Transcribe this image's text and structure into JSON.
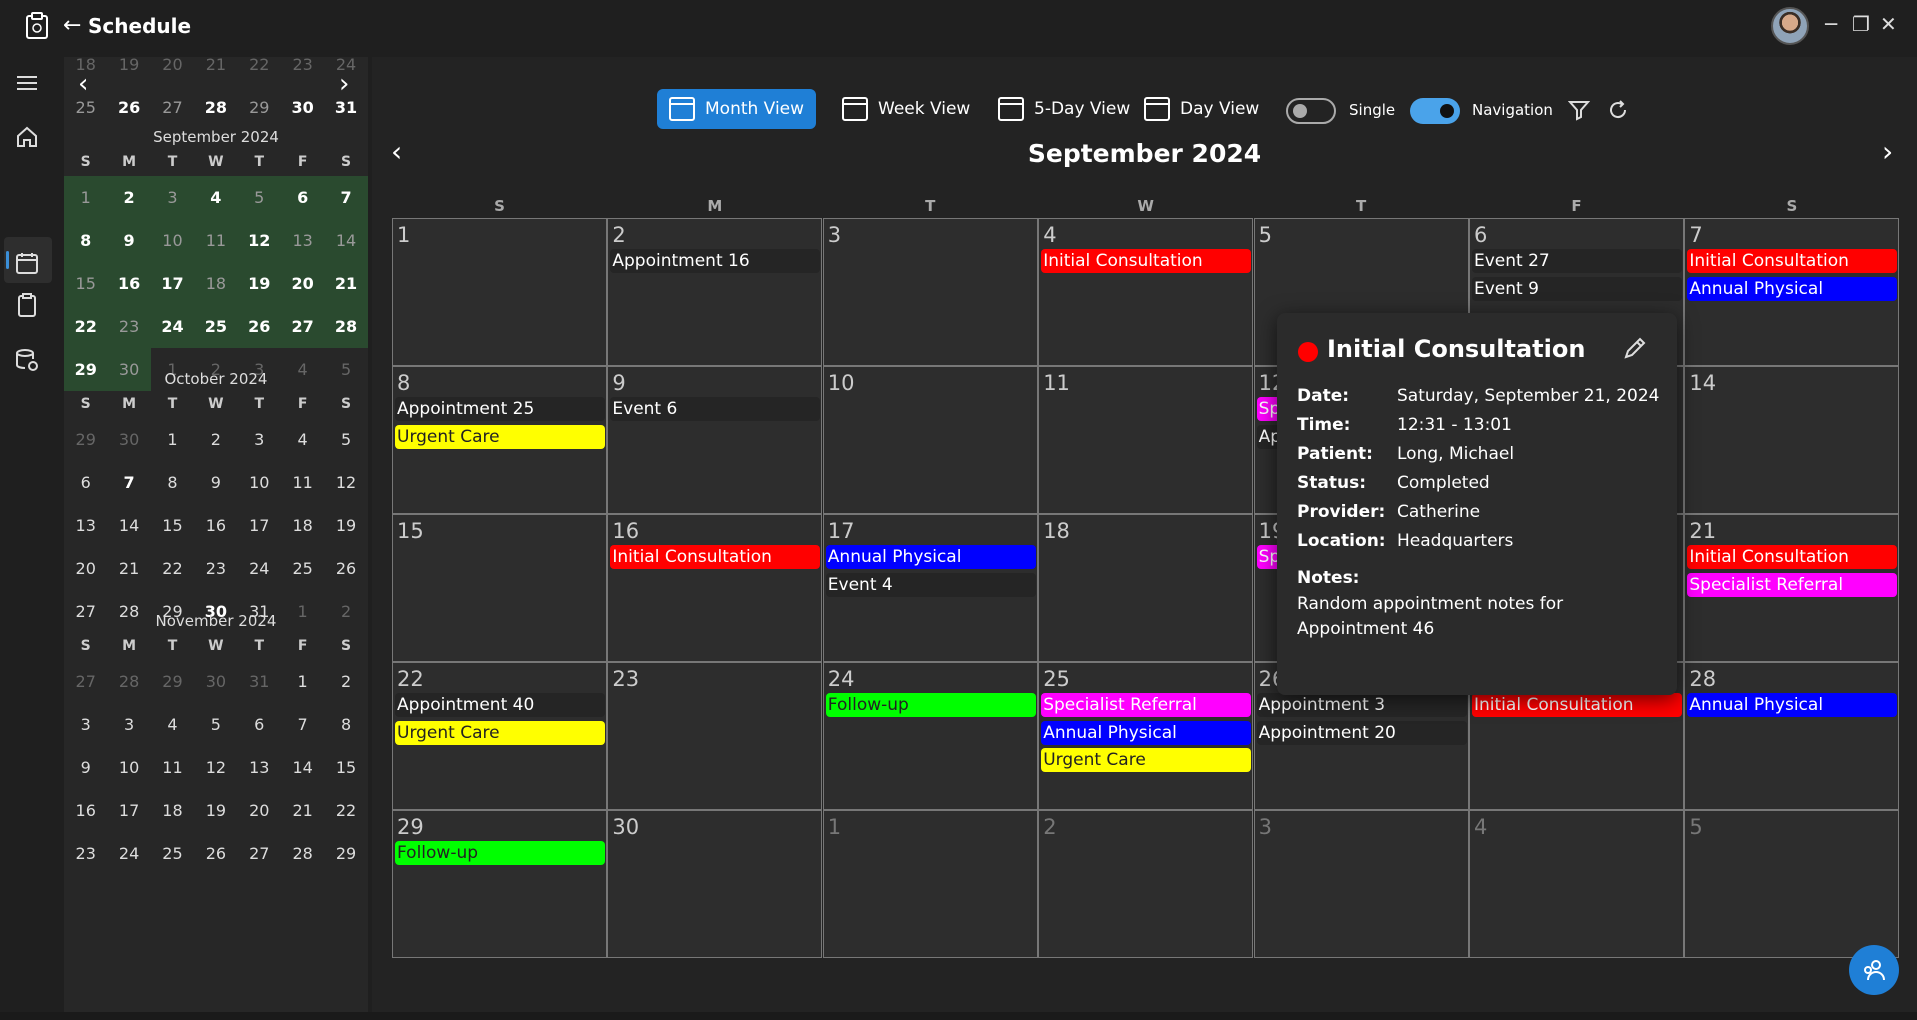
{
  "app": {
    "title": "Schedule"
  },
  "nav_rail": [
    "menu-icon",
    "home-icon",
    "calendar-icon",
    "clipboard-icon",
    "database-settings-icon"
  ],
  "mini_calendars": [
    {
      "title": "",
      "rows": [
        [
          "18",
          "19",
          "20",
          "21",
          "22",
          "23",
          "24"
        ],
        [
          "25",
          "26",
          "27",
          "28",
          "29",
          "30",
          "31"
        ]
      ]
    },
    {
      "title": "September 2024",
      "days": [
        "S",
        "M",
        "T",
        "W",
        "T",
        "F",
        "S"
      ],
      "rows": [
        [
          "1",
          "2",
          "3",
          "4",
          "5",
          "6",
          "7"
        ],
        [
          "8",
          "9",
          "10",
          "11",
          "12",
          "13",
          "14"
        ],
        [
          "15",
          "16",
          "17",
          "18",
          "19",
          "20",
          "21"
        ],
        [
          "22",
          "23",
          "24",
          "25",
          "26",
          "27",
          "28"
        ],
        [
          "29",
          "30",
          "1",
          "2",
          "3",
          "4",
          "5"
        ]
      ]
    },
    {
      "title": "October 2024",
      "days": [
        "S",
        "M",
        "T",
        "W",
        "T",
        "F",
        "S"
      ],
      "rows": [
        [
          "29",
          "30",
          "1",
          "2",
          "3",
          "4",
          "5"
        ],
        [
          "6",
          "7",
          "8",
          "9",
          "10",
          "11",
          "12"
        ],
        [
          "13",
          "14",
          "15",
          "16",
          "17",
          "18",
          "19"
        ],
        [
          "20",
          "21",
          "22",
          "23",
          "24",
          "25",
          "26"
        ],
        [
          "27",
          "28",
          "29",
          "30",
          "31",
          "1",
          "2"
        ]
      ]
    },
    {
      "title": "November 2024",
      "days": [
        "S",
        "M",
        "T",
        "W",
        "T",
        "F",
        "S"
      ],
      "rows": [
        [
          "27",
          "28",
          "29",
          "30",
          "31",
          "1",
          "2"
        ],
        [
          "3",
          "3",
          "4",
          "5",
          "6",
          "7",
          "8"
        ],
        [
          "9",
          "10",
          "11",
          "12",
          "13",
          "14",
          "15"
        ],
        [
          "16",
          "17",
          "18",
          "19",
          "20",
          "21",
          "22"
        ],
        [
          "23",
          "24",
          "25",
          "26",
          "27",
          "28",
          "29"
        ]
      ]
    }
  ],
  "toolbar": {
    "month_view": "Month View",
    "week_view": "Week View",
    "five_day_view": "5-Day View",
    "day_view": "Day View",
    "single_label": "Single",
    "navigation_label": "Navigation",
    "single_on": false,
    "navigation_on": true
  },
  "calendar": {
    "title": "September 2024",
    "days": [
      "S",
      "M",
      "T",
      "W",
      "T",
      "F",
      "S"
    ],
    "weeks": [
      [
        {
          "d": "1",
          "ev": []
        },
        {
          "d": "2",
          "ev": [
            [
              "Appointment 16",
              "plain"
            ]
          ]
        },
        {
          "d": "3",
          "ev": []
        },
        {
          "d": "4",
          "ev": [
            [
              "Initial Consultation",
              "red"
            ]
          ]
        },
        {
          "d": "5",
          "ev": []
        },
        {
          "d": "6",
          "ev": [
            [
              "Event 27",
              "plain"
            ],
            [
              "Event 9",
              "plain"
            ]
          ]
        },
        {
          "d": "7",
          "ev": [
            [
              "Initial Consultation",
              "red"
            ],
            [
              "Annual Physical",
              "blue"
            ]
          ]
        }
      ],
      [
        {
          "d": "8",
          "ev": [
            [
              "Appointment 25",
              "plain"
            ],
            [
              "Urgent Care",
              "yellow"
            ]
          ]
        },
        {
          "d": "9",
          "ev": [
            [
              "Event 6",
              "plain"
            ]
          ]
        },
        {
          "d": "10",
          "ev": []
        },
        {
          "d": "11",
          "ev": []
        },
        {
          "d": "12",
          "ev": [
            [
              "Sp",
              "magenta"
            ],
            [
              "Ap",
              "plain"
            ]
          ]
        },
        {
          "d": "13",
          "ev": []
        },
        {
          "d": "14",
          "ev": []
        }
      ],
      [
        {
          "d": "15",
          "ev": []
        },
        {
          "d": "16",
          "ev": [
            [
              "Initial Consultation",
              "red"
            ]
          ]
        },
        {
          "d": "17",
          "ev": [
            [
              "Annual Physical",
              "blue"
            ],
            [
              "Event 4",
              "plain"
            ]
          ]
        },
        {
          "d": "18",
          "ev": []
        },
        {
          "d": "19",
          "ev": [
            [
              "Sp",
              "magenta"
            ]
          ]
        },
        {
          "d": "20",
          "ev": []
        },
        {
          "d": "21",
          "ev": [
            [
              "Initial Consultation",
              "red"
            ],
            [
              "Specialist Referral",
              "magenta"
            ]
          ]
        }
      ],
      [
        {
          "d": "22",
          "ev": [
            [
              "Appointment 40",
              "plain"
            ],
            [
              "Urgent Care",
              "yellow"
            ]
          ]
        },
        {
          "d": "23",
          "ev": []
        },
        {
          "d": "24",
          "ev": [
            [
              "Follow-up",
              "green"
            ]
          ]
        },
        {
          "d": "25",
          "ev": [
            [
              "Specialist Referral",
              "magenta"
            ],
            [
              "Annual Physical",
              "blue"
            ],
            [
              "Urgent Care",
              "yellow"
            ]
          ]
        },
        {
          "d": "26",
          "ev": [
            [
              "Appointment 3",
              "plain"
            ],
            [
              "Appointment 20",
              "plain"
            ]
          ]
        },
        {
          "d": "27",
          "ev": [
            [
              "Initial Consultation",
              "red"
            ]
          ]
        },
        {
          "d": "28",
          "ev": [
            [
              "Annual Physical",
              "blue"
            ]
          ]
        }
      ],
      [
        {
          "d": "29",
          "ev": [
            [
              "Follow-up",
              "green"
            ]
          ]
        },
        {
          "d": "30",
          "ev": []
        },
        {
          "d": "1",
          "o": true,
          "ev": []
        },
        {
          "d": "2",
          "o": true,
          "ev": []
        },
        {
          "d": "3",
          "o": true,
          "ev": []
        },
        {
          "d": "4",
          "o": true,
          "ev": []
        },
        {
          "d": "5",
          "o": true,
          "ev": []
        }
      ]
    ]
  },
  "popup": {
    "title": "Initial Consultation",
    "dot_color": "#ff0000",
    "date_label": "Date:",
    "date": "Saturday, September 21, 2024",
    "time_label": "Time:",
    "time": "12:31 - 13:01",
    "patient_label": "Patient:",
    "patient": "Long, Michael",
    "status_label": "Status:",
    "status": "Completed",
    "provider_label": "Provider:",
    "provider": "Catherine",
    "location_label": "Location:",
    "location": "Headquarters",
    "notes_label": "Notes:",
    "notes_line1": "Random appointment notes for",
    "notes_line2": "Appointment 46"
  }
}
